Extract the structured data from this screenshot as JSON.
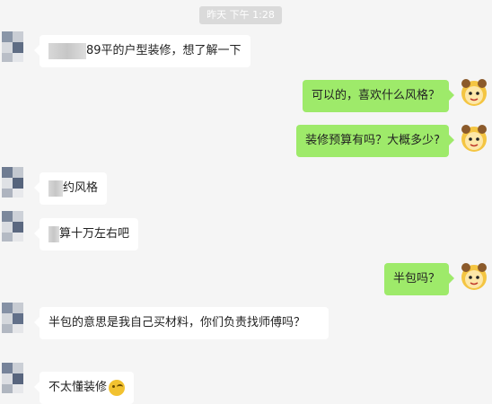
{
  "timestamp": "昨天 下午 1:28",
  "messages": [
    {
      "side": "in",
      "text": "89平的户型装修，想了解一下"
    },
    {
      "side": "out",
      "text": "可以的，喜欢什么风格？"
    },
    {
      "side": "out",
      "text": "装修预算有吗？大概多少?"
    },
    {
      "side": "in",
      "text": "约风格"
    },
    {
      "side": "in",
      "text": "算十万左右吧"
    },
    {
      "side": "out",
      "text": "半包吗？"
    },
    {
      "side": "in",
      "text": "半包的意思是我自己买材料，你们负责找师傅吗？"
    },
    {
      "side": "in",
      "text": "不太懂装修",
      "emoji": "embarrassed-face-icon"
    }
  ],
  "colors": {
    "background": "#f5f5f5",
    "incoming_bubble": "#ffffff",
    "outgoing_bubble": "#9eea6a",
    "time_badge": "#dadada"
  }
}
